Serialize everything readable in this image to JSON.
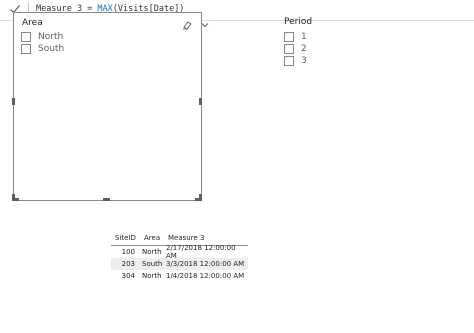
{
  "formula": {
    "prefix": "Measure 3 = ",
    "function": "MAX",
    "args": "(Visits[Date])"
  },
  "area_slicer": {
    "title": "Area",
    "items": [
      "North",
      "South"
    ]
  },
  "period_slicer": {
    "title": "Period",
    "items": [
      "1",
      "2",
      "3"
    ]
  },
  "table": {
    "headers": [
      "SiteID",
      "Area",
      "Measure 3"
    ],
    "rows": [
      [
        "100",
        "North",
        "2/17/2018 12:00:00 AM"
      ],
      [
        "203",
        "South",
        "3/3/2018 12:00:00 AM"
      ],
      [
        "304",
        "North",
        "1/4/2018 12:00:00 AM"
      ]
    ]
  },
  "colors": {
    "accent_underline": "#2fbfa8",
    "formula_function": "#0a6fd1",
    "border": "#8a8886"
  }
}
